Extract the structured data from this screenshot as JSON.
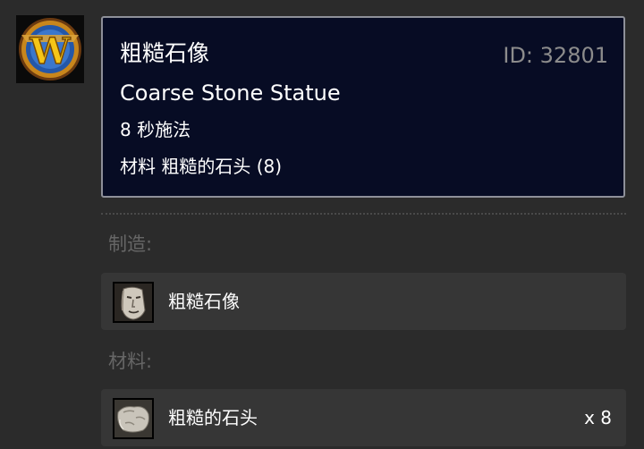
{
  "logo": {
    "icon": "wow-logo-icon",
    "letter": "W"
  },
  "tooltip": {
    "name_cn": "粗糙石像",
    "spell_id": "ID: 32801",
    "name_en": "Coarse Stone Statue",
    "cast_time": "8 秒施法",
    "reagents": "材料 粗糙的石头 (8)"
  },
  "creates": {
    "heading": "制造:",
    "items": [
      {
        "label": "粗糙石像",
        "icon": "stone-statue-icon",
        "quantity": ""
      }
    ]
  },
  "materials": {
    "heading": "材料:",
    "items": [
      {
        "label": "粗糙的石头",
        "icon": "rough-stone-icon",
        "quantity": "x 8"
      }
    ]
  },
  "colors": {
    "background": "#2b2b2b",
    "tooltip_bg": "#070c24",
    "tooltip_border": "#8e9099",
    "row_bg": "#363636",
    "muted_text": "#666666",
    "id_text": "#8c8c8c"
  }
}
